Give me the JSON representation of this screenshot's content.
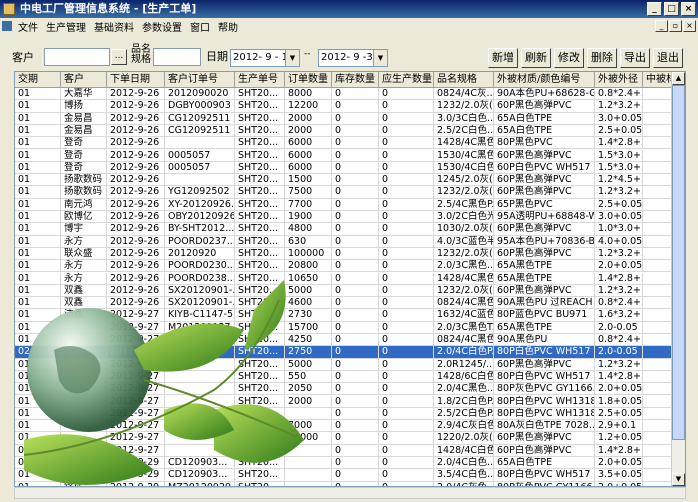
{
  "window": {
    "title": "中电工厂管理信息系统 - [生产工单]"
  },
  "menu": [
    "文件",
    "生产管理",
    "基础资料",
    "参数设置",
    "窗口",
    "帮助"
  ],
  "filters": {
    "customer_label": "客户",
    "product_label_1": "品名",
    "product_label_2": "规格",
    "date_label": "日期",
    "date_from": "2012- 9 - 1",
    "date_sep": "--",
    "date_to": "2012- 9 -30"
  },
  "toolbar": [
    "新增",
    "刷新",
    "修改",
    "删除",
    "导出",
    "退出"
  ],
  "columns": [
    "交期",
    "客户",
    "下单日期",
    "客户订单号",
    "生产单号",
    "订单数量",
    "库存数量",
    "应生产数量",
    "品名规格",
    "外被材质/颜色编号",
    "外被外径",
    "中被材质"
  ],
  "rows": [
    [
      "01",
      "大嘉华",
      "2012-9-26",
      "2012090020",
      "SHT20...",
      "8000",
      "0",
      "0",
      "0824/4C灰...",
      "90A本色PU+68628-GR",
      "0.8*2.4+..",
      ""
    ],
    [
      "01",
      "博扬",
      "2012-9-26",
      "DGBY000903",
      "SHT20...",
      "12200",
      "0",
      "0",
      "1232/2.0灰(...",
      "60P黑色高弹PVC",
      "1.2*3.2+..",
      ""
    ],
    [
      "01",
      "金易昌",
      "2012-9-26",
      "CG12092511",
      "SHT20...",
      "2000",
      "0",
      "0",
      "3.0/3C白色...",
      "65A白色TPE",
      "3.0+0.05",
      ""
    ],
    [
      "01",
      "金易昌",
      "2012-9-26",
      "CG12092511",
      "SHT20...",
      "2000",
      "0",
      "0",
      "2.5/2C白色...",
      "65A白色TPE",
      "2.5+0.05",
      ""
    ],
    [
      "01",
      "登奇",
      "2012-9-26",
      "",
      "SHT20...",
      "6000",
      "0",
      "0",
      "1428/4C黑色...",
      "80P黑色PVC",
      "1.4*2.8+..",
      ""
    ],
    [
      "01",
      "登奇",
      "2012-9-26",
      "0005057",
      "SHT20...",
      "6000",
      "0",
      "0",
      "1530/4C黑色...",
      "60P黑色高弹PVC",
      "1.5*3.0+..",
      ""
    ],
    [
      "01",
      "登奇",
      "2012-9-26",
      "0005057",
      "SHT20...",
      "6000",
      "0",
      "0",
      "1530/4C白色...",
      "60P白色PVC  WH517",
      "1.5*3.0+..",
      ""
    ],
    [
      "01",
      "扬歌数码",
      "2012-9-26",
      "",
      "SHT20...",
      "1500",
      "0",
      "0",
      "1245/2.0灰(...",
      "60P黑色高弹PVC",
      "1.2*4.5+..",
      ""
    ],
    [
      "01",
      "扬歌数码",
      "2012-9-26",
      "YG12092502",
      "SHT20...",
      "7500",
      "0",
      "0",
      "1232/2.0灰(...",
      "60P黑色高弹PVC",
      "1.2*3.2+..",
      ""
    ],
    [
      "01",
      "南元鸿",
      "2012-9-26",
      "XY-20120926...",
      "SHT20...",
      "7700",
      "0",
      "0",
      "2.5/4C黑色P...",
      "65P黑色PVC",
      "2.5+0.05",
      ""
    ],
    [
      "01",
      "欧博亿",
      "2012-9-26",
      "OBY20120926",
      "SHT20...",
      "1900",
      "0",
      "0",
      "3.0/2C白色光...",
      "95A透明PU+68848-W",
      "3.0+0.05",
      ""
    ],
    [
      "01",
      "博宇",
      "2012-9-26",
      "BY-SHT2012...",
      "SHT20...",
      "4800",
      "0",
      "0",
      "1030/2.0灰(...",
      "60P黑色高弹PVC",
      "1.0*3.0+..",
      ""
    ],
    [
      "01",
      "永方",
      "2012-9-26",
      "POORD0237...",
      "SHT20...",
      "630",
      "0",
      "0",
      "4.0/3C蓝色半...",
      "95A本色PU+70836-B",
      "4.0+0.05",
      ""
    ],
    [
      "01",
      "联众盛",
      "2012-9-26",
      "20120920",
      "SHT20...",
      "100000",
      "0",
      "0",
      "1232/2.0灰(...",
      "60P黑色高弹PVC",
      "1.2*3.2+..",
      ""
    ],
    [
      "01",
      "永方",
      "2012-9-26",
      "POORD0230...",
      "SHT20...",
      "20800",
      "0",
      "0",
      "2.0/3C黑色...",
      "65A黑色TPE",
      "2.0+0.05",
      ""
    ],
    [
      "01",
      "永方",
      "2012-9-26",
      "POORD0238...",
      "SHT20...",
      "10650",
      "0",
      "0",
      "1428/4C黑色...",
      "65A黑色TPE",
      "1.4*2.8+..",
      ""
    ],
    [
      "01",
      "双鑫",
      "2012-9-26",
      "SX20120901-...",
      "SHT20...",
      "5000",
      "0",
      "0",
      "1232/2.0灰(...",
      "60P黑色高弹PVC",
      "1.2*3.2+..",
      ""
    ],
    [
      "01",
      "双鑫",
      "2012-9-26",
      "SX20120901-...",
      "SHT20...",
      "4600",
      "0",
      "0",
      "0824/4C黑色...",
      "90A黑色PU 过REACH",
      "0.8*2.4+..",
      ""
    ],
    [
      "01",
      "沛鑫",
      "2012-9-27",
      "KIYB-C1147-5...",
      "SHT20...",
      "2730",
      "0",
      "0",
      "1632/4C蓝色...",
      "80P蓝色PVC BU971",
      "1.6*3.2+..",
      ""
    ],
    [
      "01",
      "",
      "2012-9-27",
      "M201209127",
      "SHT20...",
      "15700",
      "0",
      "0",
      "2.0/3C黑色T...",
      "65A黑色TPE",
      "2.0-0.05",
      ""
    ],
    [
      "01",
      "",
      "2012-9-27",
      "",
      "SHT20...",
      "4250",
      "0",
      "0",
      "0824/4C黑色...",
      "90A黑色PU",
      "0.8*2.4+..",
      ""
    ],
    [
      "02",
      "",
      "2012-9-27",
      "",
      "SHT20...",
      "2750",
      "0",
      "0",
      "2.0/4C白色P...",
      "80P白色PVC  WH517",
      "2.0-0.05",
      ""
    ],
    [
      "01",
      "",
      "2012-9-27",
      "",
      "SHT20...",
      "5000",
      "0",
      "0",
      "2.0R1245/...",
      "60P黑色高弹PVC",
      "1.2*3.2+..",
      ""
    ],
    [
      "01",
      "",
      "2012-9-27",
      "",
      "SHT20...",
      "550",
      "0",
      "0",
      "1428/6C白色...",
      "80P白色PVC  WH517",
      "1.4*2.8+..",
      ""
    ],
    [
      "01",
      "",
      "2012-9-27",
      "",
      "SHT20...",
      "2050",
      "0",
      "0",
      "2.0/4C黑色...",
      "80P灰色PVC  GY1166...",
      "2.0+0.05",
      ""
    ],
    [
      "01",
      "",
      "2012-9-27",
      "",
      "SHT20...",
      "2000",
      "0",
      "0",
      "1.8/2C白色P...",
      "80P白色PVC  WH1318",
      "1.8+0.05",
      ""
    ],
    [
      "01",
      "",
      "2012-9-27",
      "",
      "SHT20...",
      "",
      "0",
      "0",
      "2.5/2C白色P...",
      "80P白色PVC  WH1318",
      "2.5+0.05",
      ""
    ],
    [
      "01",
      "",
      "2012-9-27",
      "",
      "SHT20...",
      "7000",
      "0",
      "0",
      "2.9/4C灰白色...",
      "80A灰白色TPE  7028...",
      "2.9+0.1",
      ""
    ],
    [
      "01",
      "",
      "2012-9-27",
      "",
      "SHT20...",
      "34000",
      "0",
      "0",
      "1220/2.0灰(...",
      "60P黑色高弹PVC",
      "1.2+0.05",
      ""
    ],
    [
      "01",
      "",
      "2012-9-27",
      "",
      "SHT20...",
      "",
      "0",
      "0",
      "1428/4C白色...",
      "60P白色高弹PVC",
      "1.4*2.8+..",
      ""
    ],
    [
      "01",
      "",
      "2012-9-29",
      "CD120903...",
      "SHT20...",
      "",
      "0",
      "0",
      "2.0/4C白色...",
      "65A白色TPE",
      "2.0+0.05",
      ""
    ],
    [
      "01",
      "",
      "2012-9-29",
      "CD120903...",
      "SHT20...",
      "",
      "0",
      "0",
      "3.5/4C白色...",
      "80P白色PVC  WH517",
      "3.5+0.05",
      ""
    ],
    [
      "01",
      "铭征",
      "2012-9-29",
      "MZ20120929",
      "SHT20...",
      "",
      "0",
      "0",
      "2.0/4C灰色...",
      "80P灰色PVC  GY1166",
      "2.0+0.05",
      ""
    ],
    [
      "01",
      "金易昌",
      "2012-9-29",
      "CG12092813",
      "SHT20...",
      "",
      "0",
      "0",
      "1828/2C黑色...",
      "65A黑色TPE",
      "1.8*2.8+..",
      ""
    ]
  ],
  "selected_row": 21
}
